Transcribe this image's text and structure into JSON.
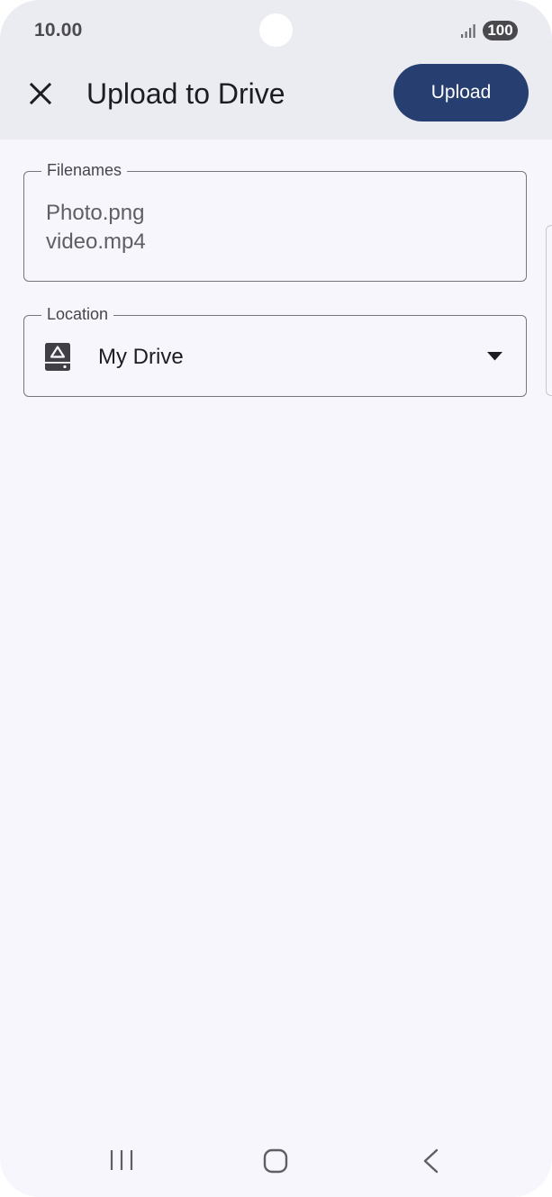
{
  "status_bar": {
    "time": "10.00",
    "battery": "100",
    "icons": [
      "signal-icon",
      "battery-icon"
    ]
  },
  "header": {
    "title": "Upload to Drive",
    "upload_label": "Upload",
    "close_icon": "close-icon"
  },
  "filenames": {
    "label": "Filenames",
    "value": "Photo.png\nvideo.mp4"
  },
  "location": {
    "label": "Location",
    "value": "My Drive",
    "icon": "drive-icon",
    "dropdown_icon": "dropdown-icon"
  },
  "nav_bar": {
    "icons": [
      "recent-apps-icon",
      "home-icon",
      "back-icon"
    ]
  },
  "colors": {
    "header_background": "#ebebf2",
    "page_background": "#f7f6fc",
    "upload_button": "#273f70",
    "field_border": "#76767e"
  }
}
